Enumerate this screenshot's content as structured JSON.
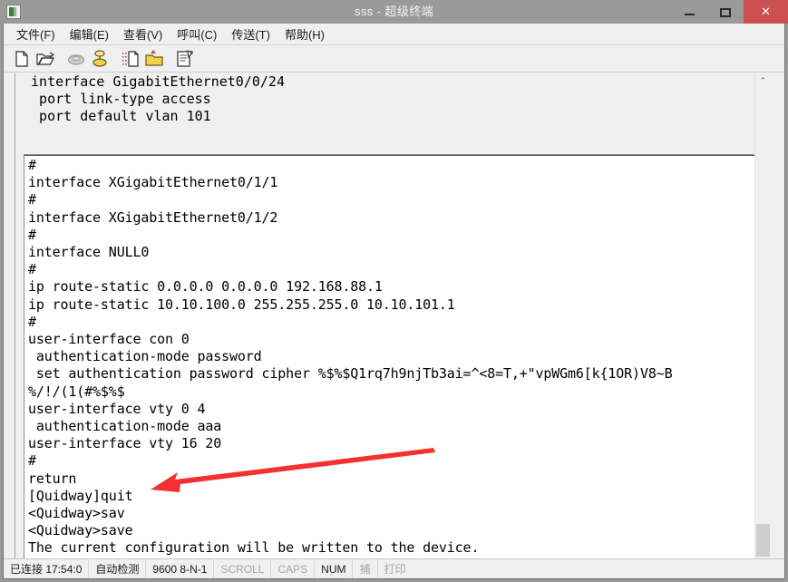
{
  "window": {
    "title": "sss - 超级终端",
    "icon": "hyperterminal-icon",
    "buttons": {
      "minimize": "—",
      "maximize": "▢",
      "close": "✕",
      "close_color": "#cb5050"
    }
  },
  "menubar": {
    "items": [
      {
        "label": "文件(F)",
        "name": "menu-file"
      },
      {
        "label": "编辑(E)",
        "name": "menu-edit"
      },
      {
        "label": "查看(V)",
        "name": "menu-view"
      },
      {
        "label": "呼叫(C)",
        "name": "menu-call"
      },
      {
        "label": "传送(T)",
        "name": "menu-transfer"
      },
      {
        "label": "帮助(H)",
        "name": "menu-help"
      }
    ]
  },
  "toolbar": {
    "buttons": [
      {
        "name": "new-connection-icon",
        "title": "新建连接",
        "enabled": true
      },
      {
        "name": "open-icon",
        "title": "打开",
        "enabled": true
      },
      {
        "name": "disconnect-icon",
        "title": "断开",
        "enabled": false
      },
      {
        "name": "call-icon",
        "title": "呼叫",
        "enabled": true
      },
      {
        "name": "send-file-icon",
        "title": "传送",
        "enabled": true
      },
      {
        "name": "receive-file-icon",
        "title": "接收",
        "enabled": true
      },
      {
        "name": "properties-icon",
        "title": "属性",
        "enabled": true
      }
    ]
  },
  "terminal": {
    "header_lines": " interface GigabitEthernet0/0/24\n  port link-type access\n  port default vlan 101",
    "body_lines": "#\ninterface XGigabitEthernet0/1/1\n#\ninterface XGigabitEthernet0/1/2\n#\ninterface NULL0\n#\nip route-static 0.0.0.0 0.0.0.0 192.168.88.1\nip route-static 10.10.100.0 255.255.255.0 10.10.101.1\n#\nuser-interface con 0\n authentication-mode password\n set authentication password cipher %$%$Q1rq7h9njTb3ai=^<8=T,+\"vpWGm6[k{1OR)V8~B\n%/!/(1(#%$%$\nuser-interface vty 0 4\n authentication-mode aaa\nuser-interface vty 16 20\n#\nreturn\n[Quidway]quit\n<Quidway>sav\n<Quidway>save\nThe current configuration will be written to the device.\nAre you sure to continue?[Y/N]",
    "cursor": "_"
  },
  "scrollbar": {
    "up_arrow": "⌃",
    "down_arrow": "⌄"
  },
  "annotation": {
    "arrow_color": "#f43030",
    "points_to": "save"
  },
  "statusbar": {
    "cells": [
      {
        "label": "已连接 17:54:0",
        "name": "status-connection",
        "dim": false
      },
      {
        "label": "自动检测",
        "name": "status-detect",
        "dim": false
      },
      {
        "label": "9600 8-N-1",
        "name": "status-baud",
        "dim": false
      },
      {
        "label": "SCROLL",
        "name": "status-scroll",
        "dim": true
      },
      {
        "label": "CAPS",
        "name": "status-caps",
        "dim": true
      },
      {
        "label": "NUM",
        "name": "status-num",
        "dim": false
      },
      {
        "label": "捕",
        "name": "status-capture",
        "dim": true
      },
      {
        "label": "打印",
        "name": "status-print",
        "dim": true
      }
    ]
  }
}
